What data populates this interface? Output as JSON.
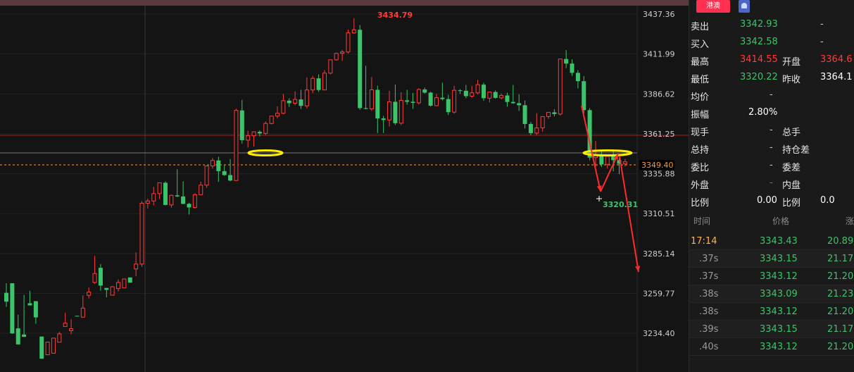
{
  "chart": {
    "y_labels": [
      "3437.36",
      "3411.99",
      "3386.62",
      "3361.25",
      "3335.88",
      "3310.51",
      "3285.14",
      "3259.77",
      "3234.40"
    ],
    "current_price_tag": "3349.40",
    "high_marker": "3434.79",
    "low_marker": "3320.31",
    "colors": {
      "up": "#ff3b3b",
      "down": "#3cc46a",
      "highlight": "#ffee00",
      "arrow": "#ff2a2a"
    },
    "candles": [
      [
        3260.1,
        3266.2,
        3254.5,
        3251.2
      ],
      [
        3266.2,
        3255.9,
        3234.3,
        3234.0
      ],
      [
        3237.5,
        3246.2,
        3227.3,
        3228.9
      ],
      [
        3233.6,
        3258.8,
        3232.1,
        3232.1
      ],
      [
        3253.5,
        3261.4,
        3252.1,
        3252.3
      ],
      [
        3254.8,
        3249.3,
        3244.5,
        3240.5
      ],
      [
        3232.3,
        3219.4,
        3218.2,
        3218.8
      ],
      [
        3220.7,
        3226.0,
        3228.8,
        3227.0
      ],
      [
        3221.7,
        3225.1,
        3231.3,
        3225.3
      ],
      [
        3228.7,
        3235.3,
        3234.0,
        3230.5
      ],
      [
        3238.7,
        3247.5,
        3240.8,
        3240.6
      ],
      [
        3236.0,
        3243.3,
        3237.3,
        3233.7
      ],
      [
        3245.5,
        3245.4,
        3245.3,
        3248.4
      ],
      [
        3244.6,
        3258.5,
        3250.4,
        3246.3
      ],
      [
        3258.5,
        3263.5,
        3260.6,
        3256.5
      ],
      [
        3266.7,
        3283.6,
        3272.4,
        3265.8
      ],
      [
        3276.0,
        3278.4,
        3264.7,
        3261.4
      ],
      [
        3263.2,
        3262.9,
        3262.0,
        3257.2
      ],
      [
        3258.6,
        3264.4,
        3264.0,
        3259.1
      ],
      [
        3262.8,
        3268.5,
        3266.7,
        3261.0
      ],
      [
        3263.2,
        3265.0,
        3268.9,
        3265.5
      ],
      [
        3269.9,
        3266.1,
        3266.6,
        3267.0
      ],
      [
        3275.3,
        3285.8,
        3278.4,
        3270.7
      ],
      [
        3278.4,
        3318.4,
        3317.1,
        3276.6
      ],
      [
        3317.1,
        3320.0,
        3318.5,
        3313.7
      ],
      [
        3318.5,
        3327.5,
        3323.2,
        3315.8
      ],
      [
        3323.2,
        3330.2,
        3330.1,
        3319.8
      ],
      [
        3330.1,
        3331.0,
        3316.0,
        3315.7
      ],
      [
        3316.0,
        3322.6,
        3322.1,
        3314.3
      ],
      [
        3322.1,
        3338.7,
        3321.4,
        3321.0
      ],
      [
        3321.4,
        3331.0,
        3316.7,
        3316.4
      ],
      [
        3316.7,
        3317.4,
        3314.4,
        3309.9
      ],
      [
        3314.4,
        3323.5,
        3322.5,
        3313.6
      ],
      [
        3322.5,
        3330.8,
        3328.6,
        3322.3
      ],
      [
        3328.6,
        3331.7,
        3340.8,
        3326.9
      ],
      [
        3340.8,
        3345.8,
        3344.3,
        3339.1
      ],
      [
        3344.3,
        3346.7,
        3337.5,
        3330.7
      ],
      [
        3337.5,
        3341.0,
        3335.0,
        3334.5
      ],
      [
        3335.0,
        3345.2,
        3331.5,
        3331.0
      ],
      [
        3331.5,
        3377.2,
        3376.1,
        3331.3
      ],
      [
        3376.1,
        3382.8,
        3357.2,
        3355.0
      ],
      [
        3357.2,
        3363.2,
        3360.0,
        3352.5
      ],
      [
        3360.0,
        3361.7,
        3362.5,
        3353.1
      ],
      [
        3362.5,
        3363.4,
        3361.5,
        3359.6
      ],
      [
        3361.5,
        3369.1,
        3367.8,
        3360.5
      ],
      [
        3367.8,
        3372.0,
        3372.5,
        3367.2
      ],
      [
        3372.5,
        3378.7,
        3374.3,
        3371.0
      ],
      [
        3374.3,
        3386.7,
        3382.3,
        3373.6
      ],
      [
        3382.3,
        3383.8,
        3380.7,
        3378.3
      ],
      [
        3380.7,
        3388.2,
        3383.1,
        3379.4
      ],
      [
        3383.1,
        3389.2,
        3379.0,
        3377.1
      ],
      [
        3379.0,
        3397.1,
        3389.1,
        3377.4
      ],
      [
        3389.1,
        3398.0,
        3396.5,
        3387.1
      ],
      [
        3396.5,
        3399.0,
        3389.1,
        3387.9
      ],
      [
        3389.1,
        3401.7,
        3399.8,
        3389.3
      ],
      [
        3399.8,
        3406.0,
        3408.3,
        3399.1
      ],
      [
        3408.3,
        3412.8,
        3412.4,
        3407.8
      ],
      [
        3412.4,
        3414.6,
        3413.3,
        3407.6
      ],
      [
        3413.3,
        3427.6,
        3425.4,
        3412.2
      ],
      [
        3425.4,
        3434.8,
        3427.4,
        3424.8
      ],
      [
        3427.4,
        3430.4,
        3377.6,
        3376.5
      ],
      [
        3377.6,
        3404.5,
        3377.1,
        3376.8
      ],
      [
        3377.1,
        3397.4,
        3389.2,
        3375.8
      ],
      [
        3389.2,
        3391.8,
        3371.0,
        3361.7
      ],
      [
        3371.0,
        3372.6,
        3370.0,
        3361.8
      ],
      [
        3370.0,
        3388.6,
        3381.6,
        3365.9
      ],
      [
        3381.6,
        3392.6,
        3368.0,
        3366.8
      ],
      [
        3368.0,
        3387.6,
        3382.5,
        3366.8
      ],
      [
        3382.5,
        3389.2,
        3381.6,
        3379.8
      ],
      [
        3381.6,
        3387.2,
        3380.9,
        3377.1
      ],
      [
        3380.9,
        3390.2,
        3389.4,
        3379.9
      ],
      [
        3389.4,
        3390.6,
        3387.4,
        3386.9
      ],
      [
        3387.4,
        3388.0,
        3379.1,
        3378.5
      ],
      [
        3379.1,
        3386.5,
        3384.2,
        3378.8
      ],
      [
        3384.2,
        3393.7,
        3383.3,
        3382.5
      ],
      [
        3383.3,
        3386.0,
        3375.0,
        3373.2
      ],
      [
        3375.0,
        3391.8,
        3388.9,
        3374.0
      ],
      [
        3388.9,
        3389.6,
        3388.6,
        3386.6
      ],
      [
        3388.6,
        3392.3,
        3385.2,
        3383.9
      ],
      [
        3385.2,
        3391.8,
        3387.3,
        3384.2
      ],
      [
        3387.3,
        3395.6,
        3392.5,
        3386.2
      ],
      [
        3392.5,
        3393.7,
        3383.9,
        3382.2
      ],
      [
        3383.9,
        3385.5,
        3387.8,
        3381.2
      ],
      [
        3387.8,
        3388.8,
        3384.1,
        3383.6
      ],
      [
        3384.1,
        3386.8,
        3385.6,
        3383.1
      ],
      [
        3385.6,
        3387.4,
        3381.5,
        3378.5
      ],
      [
        3381.5,
        3392.3,
        3380.7,
        3380.3
      ],
      [
        3380.7,
        3386.4,
        3379.4,
        3375.8
      ],
      [
        3379.4,
        3382.4,
        3367.5,
        3364.7
      ],
      [
        3367.5,
        3368.8,
        3361.7,
        3360.4
      ],
      [
        3361.7,
        3374.3,
        3365.0,
        3360.5
      ],
      [
        3365.0,
        3371.3,
        3372.2,
        3362.6
      ],
      [
        3372.2,
        3374.8,
        3374.9,
        3370.8
      ],
      [
        3374.9,
        3376.9,
        3373.8,
        3372.3
      ],
      [
        3373.8,
        3377.1,
        3408.8,
        3372.8
      ],
      [
        3408.8,
        3414.5,
        3405.9,
        3403.0
      ],
      [
        3405.9,
        3408.6,
        3400.0,
        3398.1
      ],
      [
        3400.0,
        3401.7,
        3394.7,
        3390.1
      ],
      [
        3394.7,
        3397.9,
        3376.3,
        3374.2
      ],
      [
        3376.3,
        3377.6,
        3346.1,
        3344.4
      ],
      [
        3346.1,
        3356.6,
        3348.0,
        3337.6
      ],
      [
        3348.0,
        3350.4,
        3341.8,
        3340.1
      ],
      [
        3341.8,
        3346.8,
        3346.9,
        3339.2
      ],
      [
        3346.9,
        3351.0,
        3344.5,
        3337.4
      ],
      [
        3344.5,
        3345.8,
        3342.2,
        3335.6
      ],
      [
        3342.2,
        3345.2,
        3343.4,
        3340.5
      ]
    ]
  },
  "panel": {
    "badge": "港澳",
    "quote": [
      {
        "label": "卖出",
        "value": "3342.93",
        "right": "-"
      },
      {
        "label": "买入",
        "value": "3342.58",
        "right": "-"
      },
      {
        "label": "最高",
        "value": "3414.55",
        "label2": "开盘",
        "value2": "3364.6"
      },
      {
        "label": "最低",
        "value": "3320.22",
        "label2": "昨收",
        "value2": "3364.1"
      },
      {
        "label": "均价",
        "value": "-"
      },
      {
        "label": "振幅",
        "value": "2.80%"
      },
      {
        "label": "现手",
        "value": "-",
        "label2": "总手"
      },
      {
        "label": "总持",
        "value": "-",
        "label2": "持仓差"
      },
      {
        "label": "委比",
        "value": "-",
        "label2": "委差"
      },
      {
        "label": "外盘",
        "value": "-",
        "label2": "内盘"
      },
      {
        "label": "比例",
        "value": "0.00",
        "label2": "比例",
        "value2": "0.0"
      }
    ],
    "ticks_header": {
      "time": "时间",
      "price": "价格",
      "change": "涨"
    },
    "ticks": [
      {
        "time": "17:14",
        "price": "3343.43",
        "change": "20.89"
      },
      {
        "time": ".37s",
        "price": "3343.15",
        "change": "21.17"
      },
      {
        "time": ".37s",
        "price": "3343.12",
        "change": "21.20"
      },
      {
        "time": ".38s",
        "price": "3343.09",
        "change": "21.23"
      },
      {
        "time": ".38s",
        "price": "3343.12",
        "change": "21.20"
      },
      {
        "time": ".39s",
        "price": "3343.15",
        "change": "21.17"
      },
      {
        "time": ".40s",
        "price": "3343.12",
        "change": "21.20"
      }
    ]
  }
}
